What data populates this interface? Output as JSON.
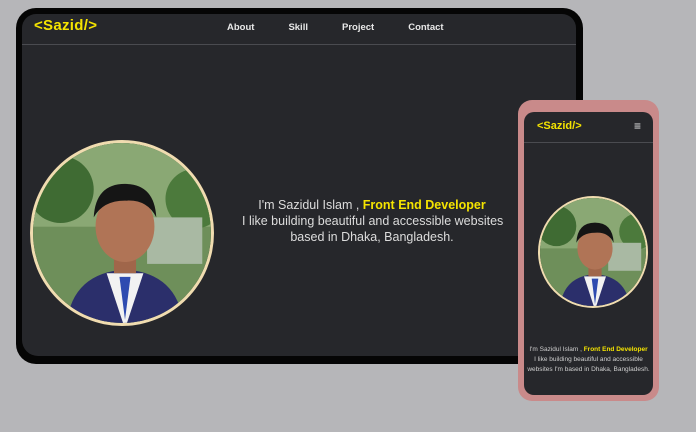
{
  "brand": {
    "logo": "<Sazid/>"
  },
  "desktop": {
    "nav": [
      "About",
      "Skill",
      "Project",
      "Contact"
    ],
    "intro_prefix": "I'm Sazidul Islam , ",
    "intro_role": "Front End Developer",
    "line2": "I like building beautiful and accessible websites",
    "line3": "based in Dhaka, Bangladesh."
  },
  "mobile": {
    "menu_icon": "≡",
    "intro_prefix": "I'm Sazidul Islam , ",
    "intro_role": "Front End Developer",
    "body": "I like building beautiful and accessible websites I'm based in Dhaka, Bangladesh."
  },
  "colors": {
    "accent": "#f5e400",
    "screen_bg": "#26272b",
    "phone_frame": "#c98a8a",
    "avatar_border": "#f0dcb0"
  }
}
